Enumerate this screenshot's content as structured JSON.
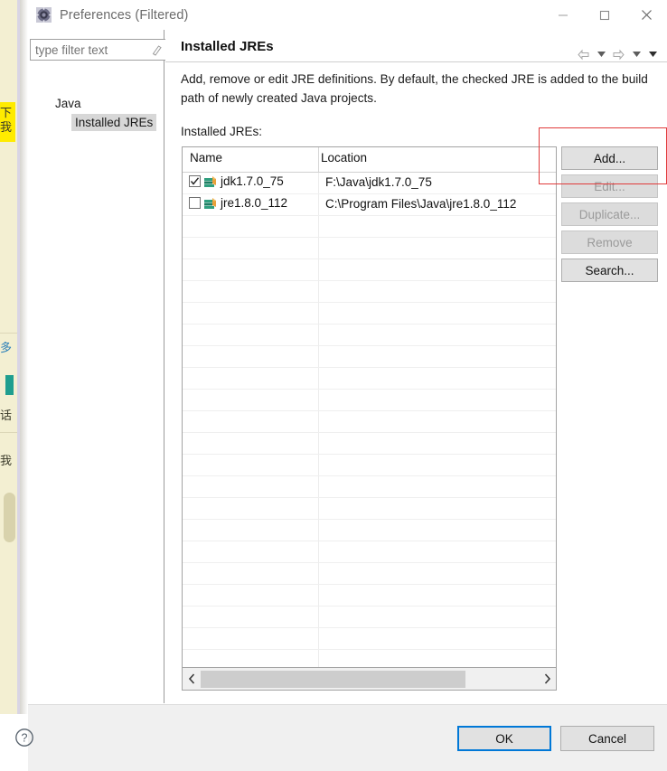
{
  "window": {
    "title": "Preferences (Filtered)",
    "icon": "eclipse-preferences-icon",
    "minimize_label": "—",
    "maximize_label": "□",
    "close_label": "✕"
  },
  "left_pane": {
    "filter": {
      "value": "",
      "placeholder": "type filter text",
      "clear_icon": "clear-filter-icon"
    },
    "tree": [
      {
        "label": "Java",
        "selected": false
      },
      {
        "label": "Installed JREs",
        "selected": true
      }
    ]
  },
  "page": {
    "title": "Installed JREs",
    "description": "Add, remove or edit JRE definitions. By default, the checked JRE is added to the build path of newly created Java projects.",
    "list_label": "Installed JREs:",
    "nav": {
      "back_icon": "back-arrow-icon",
      "back_menu_icon": "chevron-down-icon",
      "forward_icon": "forward-arrow-icon",
      "forward_menu_icon": "chevron-down-icon",
      "view_menu_icon": "chevron-down-icon"
    }
  },
  "table": {
    "columns": [
      "Name",
      "Location"
    ],
    "rows": [
      {
        "checked": true,
        "icon": "jre-icon",
        "name": "jdk1.7.0_75",
        "location": "F:\\Java\\jdk1.7.0_75"
      },
      {
        "checked": false,
        "icon": "jre-icon",
        "name": "jre1.8.0_112",
        "location": "C:\\Program Files\\Java\\jre1.8.0_112"
      }
    ],
    "empty_row_count": 21,
    "scrollbar": {
      "left_icon": "chevron-left-icon",
      "right_icon": "chevron-right-icon"
    }
  },
  "side_buttons": [
    {
      "label": "Add...",
      "enabled": true
    },
    {
      "label": "Edit...",
      "enabled": false
    },
    {
      "label": "Duplicate...",
      "enabled": false
    },
    {
      "label": "Remove",
      "enabled": false
    },
    {
      "label": "Search...",
      "enabled": true
    }
  ],
  "annotation": {
    "shape": "rectangle",
    "color": "#e03b3b",
    "targets": "Add... button"
  },
  "footer": {
    "help_icon": "help-question-icon",
    "ok_label": "OK",
    "cancel_label": "Cancel"
  },
  "background_app": {
    "highlight_color": "#ffeb00",
    "paper_color": "#f3efd2",
    "accent_color": "#1f9e8f",
    "glyph_fragments": [
      "下",
      "多",
      "话",
      "我"
    ]
  }
}
